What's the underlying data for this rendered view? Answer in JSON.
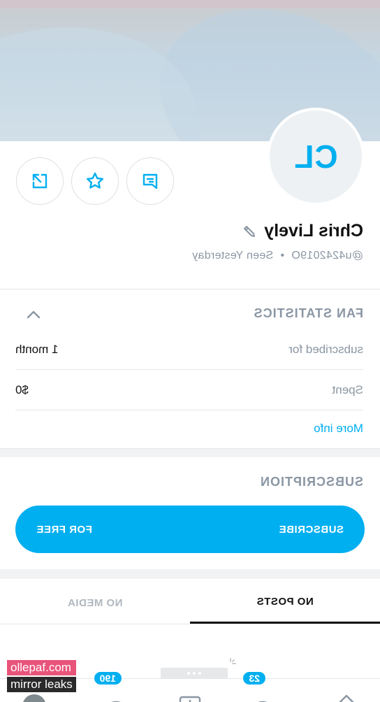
{
  "profile": {
    "initials": "CL",
    "name": "Chris Lively",
    "handle": "@u4242019O",
    "separator": "•",
    "last_seen": "Seen Yesterday"
  },
  "fan_statistics": {
    "title": "FAN STATISTICS",
    "rows": [
      {
        "label": "subscribed for",
        "value": "1 month"
      },
      {
        "label": "Spent",
        "value": "$0"
      }
    ],
    "more_info": "More info"
  },
  "subscription": {
    "title": "SUBSCRIPTION",
    "button_left": "SUBSCRIBE",
    "button_right": "FOR FREE"
  },
  "tabs": [
    {
      "label": "NO POSTS",
      "active": true
    },
    {
      "label": "NO MEDIA",
      "active": false
    }
  ],
  "bottom_nav": {
    "messages_badge": "23",
    "notifications_badge": "190"
  },
  "watermark": {
    "line1": "ollepaf.com",
    "line2": "mirror leaks"
  },
  "colors": {
    "accent": "#00aff0",
    "muted": "#8a96a3"
  },
  "icons": [
    "message-icon",
    "star-icon",
    "share-icon",
    "pencil-icon",
    "chevron-up-icon",
    "home-icon",
    "messages-icon",
    "add-icon",
    "notifications-icon",
    "avatar-icon"
  ]
}
